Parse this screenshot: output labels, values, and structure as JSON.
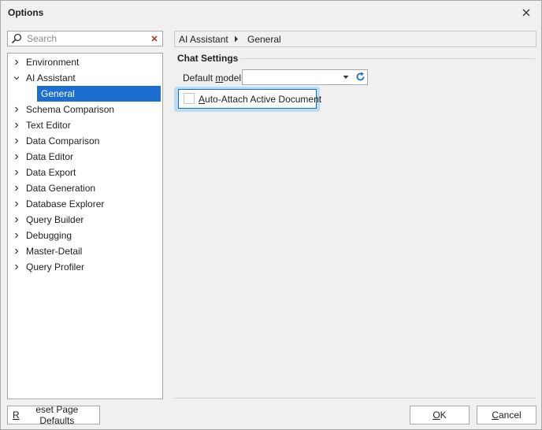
{
  "window": {
    "title": "Options"
  },
  "search": {
    "placeholder": "Search",
    "value": ""
  },
  "tree": {
    "items": [
      {
        "label": "Environment",
        "expanded": false
      },
      {
        "label": "AI Assistant",
        "expanded": true
      },
      {
        "label": "General",
        "selected": true,
        "child": true
      },
      {
        "label": "Schema Comparison",
        "expanded": false
      },
      {
        "label": "Text Editor",
        "expanded": false
      },
      {
        "label": "Data Comparison",
        "expanded": false
      },
      {
        "label": "Data Editor",
        "expanded": false
      },
      {
        "label": "Data Export",
        "expanded": false
      },
      {
        "label": "Data Generation",
        "expanded": false
      },
      {
        "label": "Database Explorer",
        "expanded": false
      },
      {
        "label": "Query Builder",
        "expanded": false
      },
      {
        "label": "Debugging",
        "expanded": false
      },
      {
        "label": "Master-Detail",
        "expanded": false
      },
      {
        "label": "Query Profiler",
        "expanded": false
      }
    ]
  },
  "breadcrumb": {
    "parent": "AI Assistant",
    "current": "General"
  },
  "settings": {
    "group_title": "Chat Settings",
    "model_label_pre": "Default ",
    "model_label_mn": "m",
    "model_label_post": "odel:",
    "model_value": "",
    "checkbox_mn": "A",
    "checkbox_label_rest": "uto-Attach Active Document",
    "checkbox_checked": false
  },
  "buttons": {
    "reset_mn": "R",
    "reset_rest": "eset Page Defaults",
    "ok_mn": "O",
    "ok_rest": "K",
    "cancel_mn": "C",
    "cancel_rest": "ancel"
  },
  "colors": {
    "selection": "#1d6ed1",
    "focus": "#0f6fc6",
    "clear_icon": "#c0392b",
    "refresh_icon": "#1f6fc5"
  }
}
